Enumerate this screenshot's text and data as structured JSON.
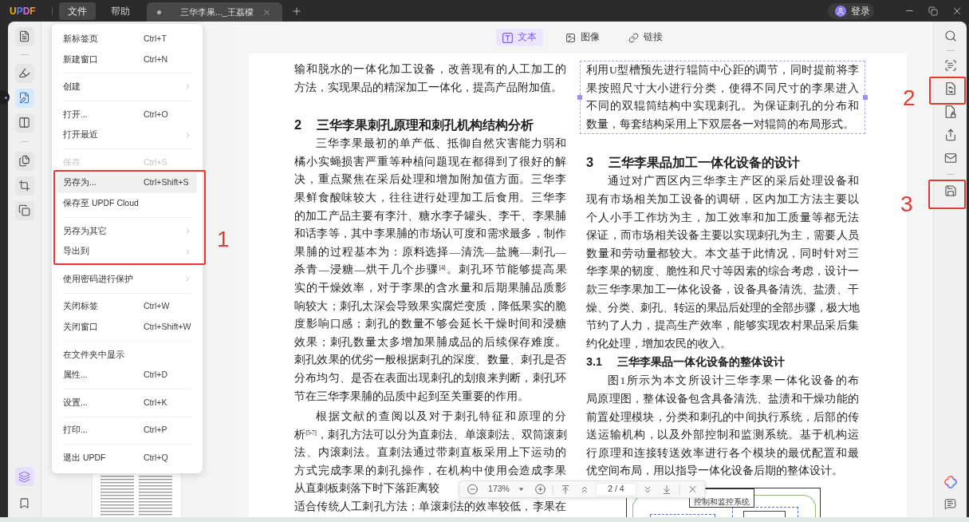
{
  "app": {
    "logo": "UPDF"
  },
  "menu_bar": [
    {
      "label": "文件",
      "selected": true
    },
    {
      "label": "帮助",
      "selected": false
    }
  ],
  "document_tabs": [
    {
      "title": "三华李果..._王荔檬",
      "selected": true,
      "unsaved": true
    }
  ],
  "account": {
    "label": "登录"
  },
  "left_rail": {
    "groups": [
      [
        {
          "selected": false
        }
      ],
      [
        {
          "selected": false
        },
        {
          "selected": true
        },
        {
          "selected": false
        }
      ],
      [
        {
          "selected": false
        },
        {
          "selected": false
        },
        {
          "selected": false
        }
      ]
    ],
    "bottom": [
      {
        "selected": true
      },
      {
        "selected": false
      }
    ]
  },
  "file_menu": {
    "groups": [
      [
        {
          "label": "新标签页",
          "shortcut": "Ctrl+T",
          "submenu": false,
          "disabled": false,
          "selected": false
        },
        {
          "label": "新建窗口",
          "shortcut": "Ctrl+N",
          "submenu": false,
          "disabled": false,
          "selected": false
        }
      ],
      [
        {
          "label": "创建",
          "submenu": true,
          "disabled": false,
          "selected": false
        }
      ],
      [
        {
          "label": "打开...",
          "shortcut": "Ctrl+O",
          "submenu": false,
          "disabled": false,
          "selected": false
        },
        {
          "label": "打开最近",
          "submenu": true,
          "disabled": false,
          "selected": false
        }
      ],
      [
        {
          "label": "保存",
          "shortcut": "Ctrl+S",
          "submenu": false,
          "disabled": true,
          "selected": false
        },
        {
          "label": "另存为...",
          "shortcut": "Ctrl+Shift+S",
          "submenu": false,
          "disabled": false,
          "selected": true
        },
        {
          "label": "保存至 UPDF Cloud",
          "submenu": false,
          "disabled": false,
          "selected": false
        }
      ],
      [
        {
          "label": "另存为其它",
          "submenu": true,
          "disabled": false,
          "selected": false
        },
        {
          "label": "导出到",
          "submenu": true,
          "disabled": false,
          "selected": false
        }
      ],
      [
        {
          "label": "使用密码进行保护",
          "submenu": true,
          "disabled": false,
          "selected": false
        }
      ],
      [
        {
          "label": "关闭标签",
          "shortcut": "Ctrl+W",
          "submenu": false,
          "disabled": false,
          "selected": false
        },
        {
          "label": "关闭窗口",
          "shortcut": "Ctrl+Shift+W",
          "submenu": false,
          "disabled": false,
          "selected": false
        }
      ],
      [
        {
          "label": "在文件夹中显示",
          "submenu": false,
          "disabled": false,
          "selected": false
        },
        {
          "label": "属性...",
          "shortcut": "Ctrl+D",
          "submenu": false,
          "disabled": false,
          "selected": false
        }
      ],
      [
        {
          "label": "设置...",
          "shortcut": "Ctrl+K",
          "submenu": false,
          "disabled": false,
          "selected": false
        }
      ],
      [
        {
          "label": "打印...",
          "shortcut": "Ctrl+P",
          "submenu": false,
          "disabled": false,
          "selected": false
        }
      ],
      [
        {
          "label": "退出 UPDF",
          "shortcut": "Ctrl+Q",
          "submenu": false,
          "disabled": false,
          "selected": false
        }
      ]
    ]
  },
  "edit_toolbar": [
    {
      "label": "文本",
      "selected": true
    },
    {
      "label": "图像",
      "selected": false
    },
    {
      "label": "链接",
      "selected": false
    }
  ],
  "document": {
    "columns": [
      {
        "blocks": [
          {
            "kind": "continuation",
            "selected": false,
            "lines": [
              "输和脱水的一体化加工设备，改善现有的人工加工的",
              "方法，实现果品的精深加工一体化，提高产品附加值。"
            ]
          },
          {
            "kind": "heading",
            "number": "2",
            "title": "三华李果刺孔原理和刺孔机构结构分析"
          },
          {
            "kind": "paragraph",
            "selected": false,
            "lines": [
              "三华李果最初的单产低、抵御自然灾害能力弱和",
              "橘小实蝇损害严重等种植问题现在都得到了很好的解",
              "决，重点聚焦在采后处理和增加附加值方面。三华李",
              "果鲜食酸味较大，往往进行处理加工后食用。三华李",
              "的加工产品主要有李汁、糖水李子罐头、李干、李果脯",
              "和话李等，其中李果脯的市场认可度和需求最多，制作",
              "果脯的过程基本为：原料选择—清洗—盐腌—刺孔—",
              "杀青—浸糖—烘干几个步骤$^{[4]}$。刺孔环节能够提高果",
              "实的干燥效率，对于李果的含水量和后期果脯品质影",
              "响较大；刺孔太深会导致果实腐烂变质，降低果实的脆",
              "度影响口感；刺孔的数量不够会延长干燥时间和浸糖",
              "效果；刺孔数量太多增加果脯成品的后续保存难度。",
              "刺孔效果的优劣一般根据刺孔的深度、数量、刺孔是否",
              "分布均匀、是否在表面出现刺孔的划痕来判断，刺孔环",
              "节在三华李果脯的品质中起到至关重要的作用。"
            ]
          },
          {
            "kind": "paragraph",
            "selected": false,
            "lines": [
              "根据文献的查阅以及对于刺孔特征和原理的分",
              "析$^{[5-7]}$，刺孔方法可以分为直刺法、单滚刺法、双筒滚刺",
              "法、内滚刺法。直刺法通过带刺直板采用上下运动的",
              "方式完成李果的刺孔操作，在机构中使用会造成李果"
            ]
          },
          {
            "kind": "continuation",
            "selected": false,
            "lines": [
              "从直刺板刺落下时下落距离较"
            ]
          },
          {
            "kind": "continuation",
            "selected": false,
            "lines": [
              "适合传统人工刺孔方法；单滚刺法的效率较低，李果在"
            ]
          }
        ]
      },
      {
        "blocks": [
          {
            "kind": "continuation",
            "selected": true,
            "lines": [
              "利用U型槽预先进行辊筒中心距的调节，同时提前将李",
              "果按照尺寸大小进行分类，使得不同尺寸的李果进入",
              "不同的双辊筒结构中实现刺孔。为保证刺孔的分布和",
              "数量，每套结构采用上下双层各一对辊筒的布局形式。"
            ]
          },
          {
            "kind": "heading",
            "number": "3",
            "title": "三华李果品加工一体化设备的设计"
          },
          {
            "kind": "paragraph",
            "selected": false,
            "lines": [
              "通过对广西区内三华李主产区的采后处理设备和",
              "现有市场相关加工设备的调研，区内加工方法主要以",
              "个人小手工作坊为主，加工效率和加工质量等都无法",
              "保证，而市场相关设备主要以实现刺孔为主，需要人员",
              "数量和劳动量都较大。本文基于此情况，同时针对三",
              "华李果的韧度、脆性和尺寸等因素的综合考虑，设计一",
              "款三华李果加工一体化设备，设备具备清洗、盐渍、干",
              "燥、分类、刺孔、转运的果品后处理的全部步骤，极大地",
              "节约了人力，提高生产效率，能够实现农村果品采后集",
              "约化处理，增加农民的收入。"
            ]
          },
          {
            "kind": "subheading",
            "number": "3.1",
            "title": "三华李果品一体化设备的整体设计"
          },
          {
            "kind": "paragraph",
            "selected": false,
            "lines": [
              "图1所示为本文所设计三华李果一体化设备的布",
              "局原理图，整体设备包含具备清洗、盐渍和干燥功能的",
              "前置处理模块，分类和刺孔的中间执行系统，后部的传",
              "送运输机构，以及外部控制和监测系统。基于机构运",
              "行原理和连接转送效率进行各个模块的最优配置和最",
              "优空间布局，用以指导一体化设备后期的整体设计。"
            ]
          },
          {
            "kind": "figure",
            "label": "控制和监控系统"
          }
        ]
      }
    ]
  },
  "zoom_bar": {
    "zoom": "173%",
    "page_field": {
      "value": "2 / 4"
    }
  },
  "annotations": [
    {
      "label": "1"
    },
    {
      "label": "2"
    },
    {
      "label": "3"
    }
  ]
}
